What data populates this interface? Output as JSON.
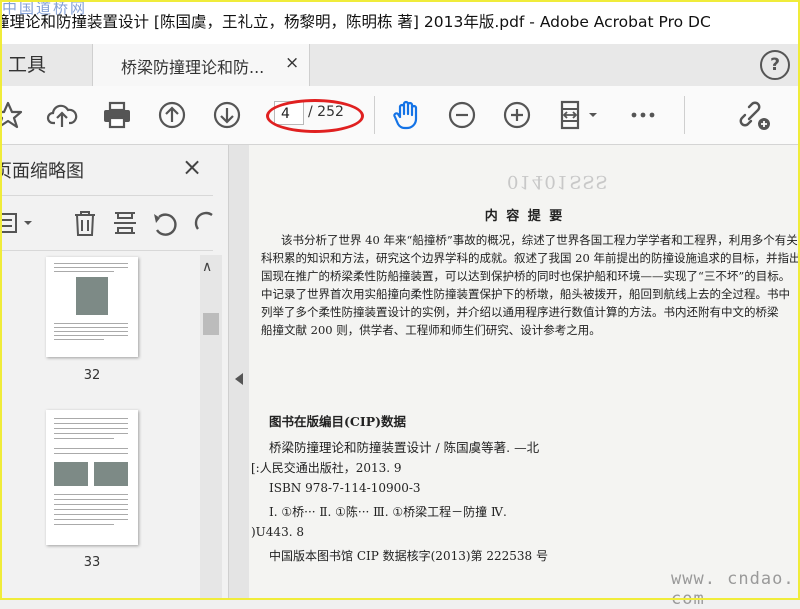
{
  "window": {
    "title": "撞理论和防撞装置设计 [陈国虞，王礼立，杨黎明，陈明栋 著] 2013年版.pdf - Adobe Acrobat Pro DC",
    "watermark": "中国道桥网"
  },
  "tabs": {
    "tools_label": "工具",
    "doc_label": "桥梁防撞理论和防...",
    "close_glyph": "×",
    "help_glyph": "?"
  },
  "toolbar": {
    "current_page": "4",
    "total_pages": "/ 252",
    "icons": [
      "bookmark-icon",
      "upload-cloud-icon",
      "print-icon",
      "previous-page-icon",
      "next-page-icon",
      "hand-tool-icon",
      "zoom-out-icon",
      "zoom-in-icon",
      "fit-page-icon",
      "more-icon",
      "share-link-icon"
    ],
    "highlight_color": "#e02020",
    "hand_color": "#1473e6"
  },
  "sidebar": {
    "title": "页面缩略图",
    "close_glyph": "×",
    "tools": [
      "options-icon",
      "delete-icon",
      "extract-icon",
      "rotate-ccw-icon",
      "rotate-cw-icon"
    ],
    "thumbnails": [
      {
        "label": "32"
      },
      {
        "label": "33"
      }
    ]
  },
  "document": {
    "stamp": "01401SSS",
    "heading": "内 容 提 要",
    "paragraph": [
      "该书分析了世界 40 年来“船撞桥”事故的概况，综述了世界各国工程力学学者和工程界，利用多个有关",
      "科积累的知识和方法，研究这个边界学科的成就。叙述了我国 20 年前提出的防撞设施追求的目标，并指出",
      "国现在推广的桥梁柔性防船撞装置，可以达到保护桥的同时也保护船和环境——实现了“三不坏”的目标。",
      "中记录了世界首次用实船撞向柔性防撞装置保护下的桥墩，船头被拨开，船回到航线上去的全过程。书中",
      "列举了多个柔性防撞装置设计的实例，并介绍以通用程序进行数值计算的方法。书内还附有中文的桥梁",
      "船撞文献 200 则，供学者、工程师和师生们研究、设计参考之用。"
    ],
    "cip_title": "图书在版编目(CIP)数据",
    "cip_lines": [
      "桥梁防撞理论和防撞装置设计 / 陈国虞等著. —北",
      "[:人民交通出版社，2013. 9",
      "ISBN 978-7-114-10900-3",
      "Ⅰ. ①桥··· Ⅱ. ①陈··· Ⅲ. ①桥梁工程－防撞 Ⅳ.",
      ")U443. 8",
      "中国版本图书馆 CIP 数据核字(2013)第 222538 号"
    ],
    "bottom_watermark": "www. cndao. com"
  }
}
